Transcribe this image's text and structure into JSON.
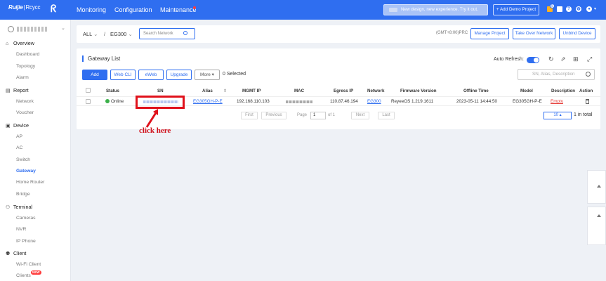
{
  "brand": {
    "name": "Ruijie",
    "sub": "Rcycc"
  },
  "topnav": {
    "monitoring": "Monitoring",
    "configuration": "Configuration",
    "maintenance": "Maintenance"
  },
  "banner": "New design, new experience. Try it out.",
  "add_demo": "+ Add Demo Project",
  "notif_count": "5",
  "sidebar": {
    "overview": "Overview",
    "overview_items": [
      "Dashboard",
      "Topology",
      "Alarm"
    ],
    "report": "Report",
    "report_items": [
      "Network",
      "Voucher"
    ],
    "device": "Device",
    "device_items": [
      "AP",
      "AC",
      "Switch",
      "Gateway",
      "Home Router",
      "Bridge"
    ],
    "terminal": "Terminal",
    "terminal_items": [
      "Cameras",
      "NVR",
      "IP Phone"
    ],
    "client": "Client",
    "client_items": [
      "Wi-Fi Client",
      "Clients"
    ],
    "new_badge": "NEW",
    "active": "Gateway"
  },
  "filter": {
    "all": "ALL",
    "slash": "/",
    "network": "EG300",
    "search_placeholder": "Search Network",
    "timezone": "(GMT+8:00)PRC",
    "manage": "Manage Project",
    "takeover": "Take Over Network",
    "unbind": "Unbind Device"
  },
  "panel": {
    "title": "Gateway List",
    "auto_refresh": "Auto Refresh:",
    "buttons": {
      "add": "Add",
      "webcli": "Web CLI",
      "eweb": "eWeb",
      "upgrade": "Upgrade",
      "more": "More ▾"
    },
    "selected": "0 Selected",
    "search_placeholder": "SN, Alias, Description"
  },
  "table": {
    "headers": [
      "Status",
      "SN",
      "Alias",
      "MGMT IP",
      "MAC",
      "Egress IP",
      "Network",
      "Firmware Version",
      "Offline Time",
      "Model",
      "Description",
      "Action"
    ],
    "row": {
      "status": "Online",
      "alias": "EG305GH-P-E",
      "mgmt_ip": "192.168.110.103",
      "egress_ip": "110.87.46.194",
      "network": "EG300",
      "firmware": "ReyeeOS 1.219.1611",
      "offline_time": "2023-05-11 14:44:50",
      "model": "EG305GH-P-E",
      "description": "Empty"
    }
  },
  "pagination": {
    "first": "First",
    "previous": "Previous",
    "page_label": "Page",
    "page": "1",
    "of": "of 1",
    "next": "Next",
    "last": "Last",
    "size": "10 ▴",
    "total": "1 in total"
  },
  "annotation": "click here",
  "colors": {
    "primary": "#2f6ef0",
    "annotation_red": "#e0111b",
    "online": "#3bb04a"
  }
}
